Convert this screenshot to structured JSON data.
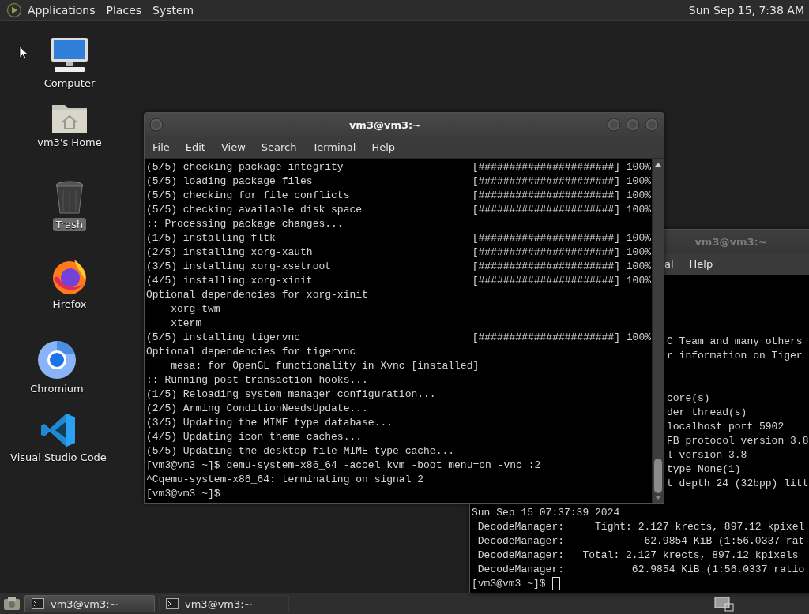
{
  "top_panel": {
    "menus": [
      "Applications",
      "Places",
      "System"
    ],
    "clock": "Sun Sep 15, 7:38 AM"
  },
  "desktop_icons": [
    {
      "kind": "computer",
      "label": "Computer",
      "selected": false
    },
    {
      "kind": "home",
      "label": "vm3's Home",
      "selected": false
    },
    {
      "kind": "trash",
      "label": "Trash",
      "selected": true
    },
    {
      "kind": "firefox",
      "label": "Firefox",
      "selected": false
    },
    {
      "kind": "chromium",
      "label": "Chromium",
      "selected": false
    },
    {
      "kind": "vscode",
      "label": "Visual Studio Code",
      "selected": false
    }
  ],
  "front_terminal": {
    "title": "vm3@vm3:~",
    "active": true,
    "menu": [
      "File",
      "Edit",
      "View",
      "Search",
      "Terminal",
      "Help"
    ],
    "lines": [
      {
        "text": "(5/5) checking package integrity",
        "progress": "[######################] 100%"
      },
      {
        "text": "(5/5) loading package files",
        "progress": "[######################] 100%"
      },
      {
        "text": "(5/5) checking for file conflicts",
        "progress": "[######################] 100%"
      },
      {
        "text": "(5/5) checking available disk space",
        "progress": "[######################] 100%"
      },
      {
        "text": ":: Processing package changes..."
      },
      {
        "text": "(1/5) installing fltk",
        "progress": "[######################] 100%"
      },
      {
        "text": "(2/5) installing xorg-xauth",
        "progress": "[######################] 100%"
      },
      {
        "text": "(3/5) installing xorg-xsetroot",
        "progress": "[######################] 100%"
      },
      {
        "text": "(4/5) installing xorg-xinit",
        "progress": "[######################] 100%"
      },
      {
        "text": "Optional dependencies for xorg-xinit"
      },
      {
        "text": "    xorg-twm"
      },
      {
        "text": "    xterm"
      },
      {
        "text": "(5/5) installing tigervnc",
        "progress": "[######################] 100%"
      },
      {
        "text": "Optional dependencies for tigervnc"
      },
      {
        "text": "    mesa: for OpenGL functionality in Xvnc [installed]"
      },
      {
        "text": ":: Running post-transaction hooks..."
      },
      {
        "text": "(1/5) Reloading system manager configuration..."
      },
      {
        "text": "(2/5) Arming ConditionNeedsUpdate..."
      },
      {
        "text": "(3/5) Updating the MIME type database..."
      },
      {
        "text": "(4/5) Updating icon theme caches..."
      },
      {
        "text": "(5/5) Updating the desktop file MIME type cache..."
      },
      {
        "text": "[vm3@vm3 ~]$ qemu-system-x86_64 -accel kvm -boot menu=on -vnc :2"
      },
      {
        "text": "^Cqemu-system-x86_64: terminating on signal 2"
      },
      {
        "text": "[vm3@vm3 ~]$"
      }
    ]
  },
  "back_terminal": {
    "title": "vm3@vm3:~",
    "active": false,
    "menu": [
      "al",
      "Help"
    ],
    "upper_lines": [
      "C Team and many others",
      "r information on Tiger"
    ],
    "middle_lines": [
      "core(s)",
      "der thread(s)",
      "localhost port 5902",
      "FB protocol version 3.8",
      "l version 3.8",
      "type None(1)",
      "t depth 24 (32bpp) litt"
    ],
    "lower_lines": [
      "Sun Sep 15 07:37:39 2024",
      " DecodeManager:     Tight: 2.127 krects, 897.12 kpixel",
      " DecodeManager:             62.9854 KiB (1:56.0337 rat",
      " DecodeManager:   Total: 2.127 krects, 897.12 kpixels",
      " DecodeManager:           62.9854 KiB (1:56.0337 ratio",
      "[vm3@vm3 ~]$"
    ],
    "cursor": true
  },
  "taskbar": {
    "tasks": [
      {
        "label": "vm3@vm3:~",
        "selected": true
      },
      {
        "label": "vm3@vm3:~",
        "selected": false
      }
    ]
  }
}
